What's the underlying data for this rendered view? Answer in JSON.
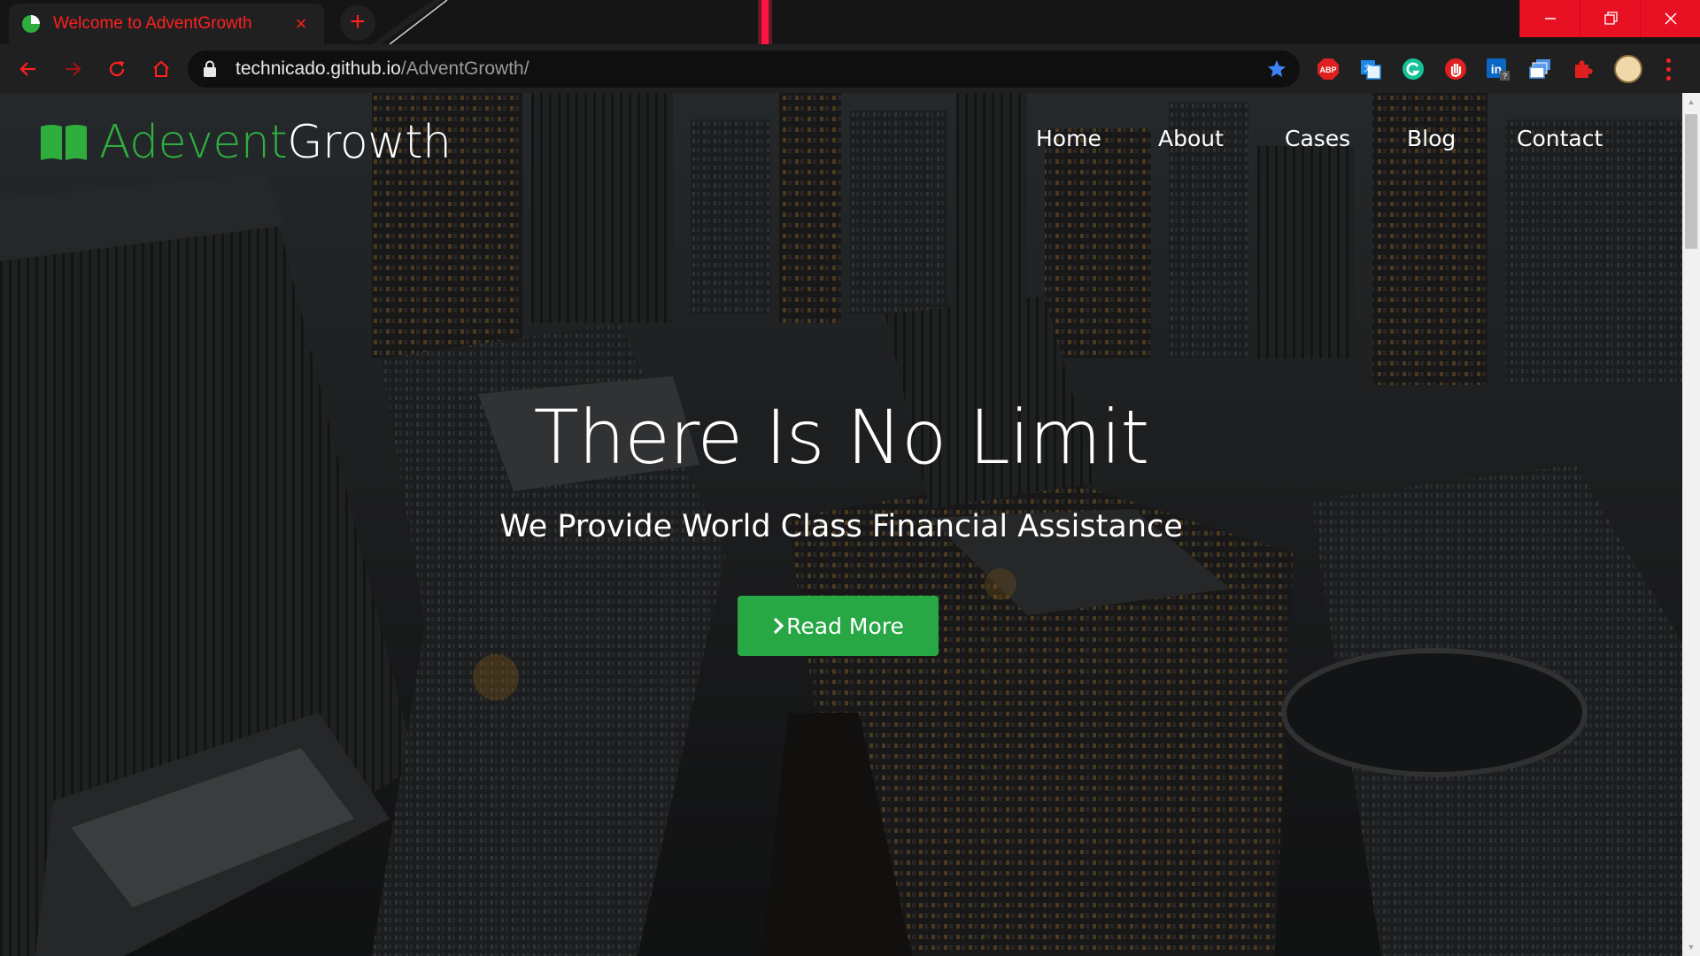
{
  "browser": {
    "tab_title": "Welcome to AdventGrowth",
    "tab_close": "×",
    "new_tab": "+",
    "url_host": "technicado.github.io",
    "url_path": "/AdventGrowth/",
    "extensions": [
      "adblock-plus-icon",
      "translate-icon",
      "grammarly-icon",
      "hand-stop-icon",
      "linkedin-icon",
      "tab-stack-icon",
      "puzzle-icon"
    ],
    "accent": "#ff2020"
  },
  "site": {
    "logo_part1": "Adevent",
    "logo_part2": "Growth",
    "brand_color": "#2fae3e",
    "nav": [
      {
        "label": "Home"
      },
      {
        "label": "About"
      },
      {
        "label": "Cases"
      },
      {
        "label": "Blog"
      },
      {
        "label": "Contact"
      }
    ],
    "hero_title": "There Is No Limit",
    "hero_subtitle": "We Provide World Class Financial Assistance",
    "cta_label": "Read More",
    "cta_color": "#28a745"
  }
}
